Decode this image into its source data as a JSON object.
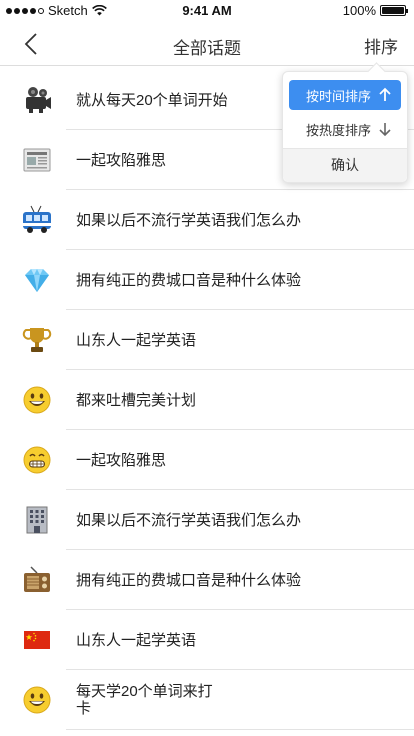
{
  "status_bar": {
    "carrier": "Sketch",
    "time": "9:41 AM",
    "battery": "100%",
    "battery_level": 1.0,
    "signal_icon": "signal-dots-icon",
    "wifi_icon": "wifi-icon",
    "battery_icon": "battery-icon"
  },
  "nav": {
    "title": "全部话题",
    "sort_label": "排序",
    "back_icon": "chevron-left-icon"
  },
  "sort_menu": {
    "options": [
      {
        "label": "按时间排序",
        "arrow": "arrow-up-icon",
        "selected": true
      },
      {
        "label": "按热度排序",
        "arrow": "arrow-down-icon",
        "selected": false
      }
    ],
    "confirm_label": "确认",
    "accent_color": "#3d8ef0"
  },
  "topics": [
    {
      "label": "就从每天20个单词开始",
      "icon": "movie-camera-icon"
    },
    {
      "label": "一起攻陷雅思",
      "icon": "newspaper-icon"
    },
    {
      "label": "如果以后不流行学英语我们怎么办",
      "icon": "trolleybus-icon"
    },
    {
      "label": "拥有纯正的费城口音是种什么体验",
      "icon": "gem-icon"
    },
    {
      "label": "山东人一起学英语",
      "icon": "trophy-icon"
    },
    {
      "label": "都来吐槽完美计划",
      "icon": "smiley-icon"
    },
    {
      "label": "一起攻陷雅思",
      "icon": "grimace-icon"
    },
    {
      "label": "如果以后不流行学英语我们怎么办",
      "icon": "office-building-icon"
    },
    {
      "label": "拥有纯正的费城口音是种什么体验",
      "icon": "radio-icon"
    },
    {
      "label": "山东人一起学英语",
      "icon": "china-flag-icon"
    },
    {
      "label": "每天学20个单词来打卡",
      "icon": "smiley-icon"
    }
  ]
}
